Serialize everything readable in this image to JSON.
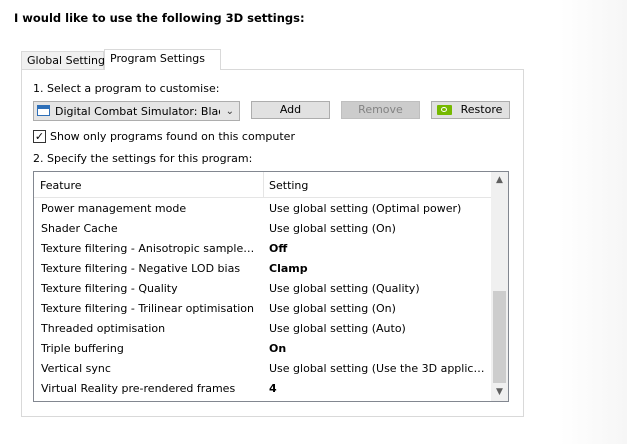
{
  "heading": "I would like to use the following 3D settings:",
  "tabs": {
    "global": "Global Settings",
    "program": "Program Settings"
  },
  "step1_label": "1. Select a program to customise:",
  "program_select": {
    "value": "Digital Combat Simulator: Black ...",
    "icon": "application-window-icon"
  },
  "buttons": {
    "add": "Add",
    "remove": "Remove",
    "restore": "Restore"
  },
  "show_only": {
    "label": "Show only programs found on this computer",
    "checked": true
  },
  "step2_label": "2. Specify the settings for this program:",
  "table": {
    "headers": {
      "feature": "Feature",
      "setting": "Setting"
    },
    "rows": [
      {
        "feature": "Power management mode",
        "setting": "Use global setting (Optimal power)",
        "bold": false
      },
      {
        "feature": "Shader Cache",
        "setting": "Use global setting (On)",
        "bold": false
      },
      {
        "feature": "Texture filtering - Anisotropic sample opti...",
        "setting": "Off",
        "bold": true
      },
      {
        "feature": "Texture filtering - Negative LOD bias",
        "setting": "Clamp",
        "bold": true
      },
      {
        "feature": "Texture filtering - Quality",
        "setting": "Use global setting (Quality)",
        "bold": false
      },
      {
        "feature": "Texture filtering - Trilinear optimisation",
        "setting": "Use global setting (On)",
        "bold": false
      },
      {
        "feature": "Threaded optimisation",
        "setting": "Use global setting (Auto)",
        "bold": false
      },
      {
        "feature": "Triple buffering",
        "setting": "On",
        "bold": true
      },
      {
        "feature": "Vertical sync",
        "setting": "Use global setting (Use the 3D application ...",
        "bold": false
      },
      {
        "feature": "Virtual Reality pre-rendered frames",
        "setting": "4",
        "bold": true
      }
    ]
  },
  "colors": {
    "accent_nvidia": "#76b900",
    "disabled_button_bg": "#cccccc"
  }
}
